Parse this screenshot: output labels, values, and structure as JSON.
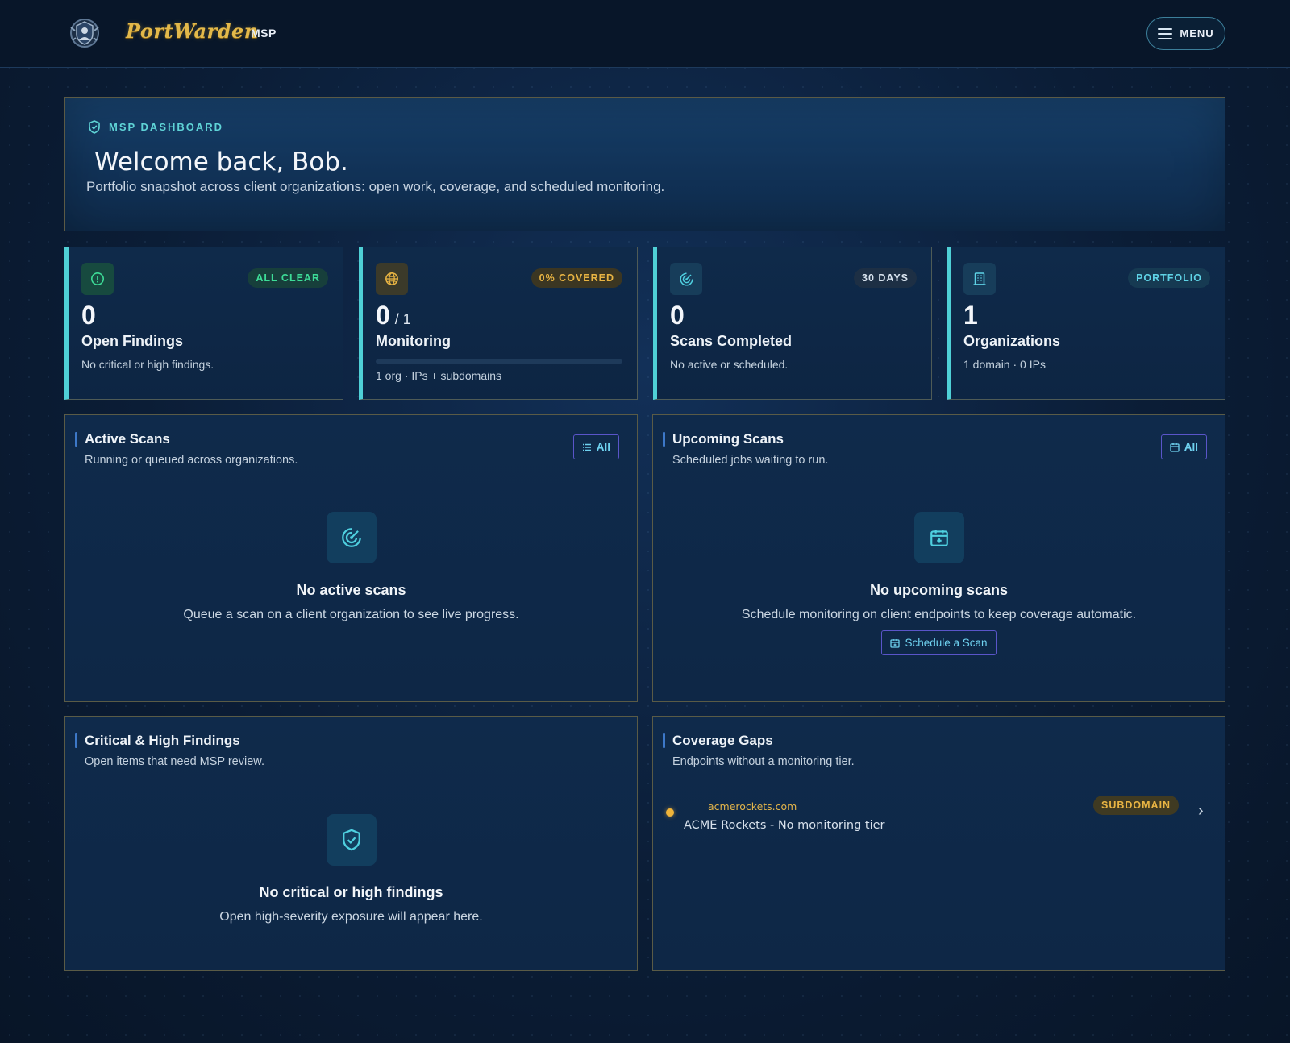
{
  "header": {
    "brand": "PortWarden",
    "brand_sub": "MSP",
    "menu_label": "MENU"
  },
  "hero": {
    "eyebrow": "MSP DASHBOARD",
    "title": "Welcome back, Bob.",
    "description": "Portfolio snapshot across client organizations: open work, coverage, and scheduled monitoring."
  },
  "stats": [
    {
      "badge": "ALL CLEAR",
      "value": "0",
      "label": "Open Findings",
      "sub": "No critical or high findings.",
      "icon": "alert-circle-icon",
      "badge_color": "#3ddc97"
    },
    {
      "badge": "0% COVERED",
      "value": "0",
      "value_suffix": "/ 1",
      "label": "Monitoring",
      "sub": "1 org · IPs + subdomains",
      "icon": "globe-icon",
      "badge_color": "#e8b443",
      "progress": 0
    },
    {
      "badge": "30 DAYS",
      "value": "0",
      "label": "Scans Completed",
      "sub": "No active or scheduled.",
      "icon": "radar-icon",
      "badge_color": "#d8e3ee"
    },
    {
      "badge": "PORTFOLIO",
      "value": "1",
      "label": "Organizations",
      "sub": "1 domain · 0 IPs",
      "icon": "building-icon",
      "badge_color": "#5fd3e6"
    }
  ],
  "panels": {
    "active_scans": {
      "title": "Active Scans",
      "subtitle": "Running or queued across organizations.",
      "button": "All",
      "empty_title": "No active scans",
      "empty_desc": "Queue a scan on a client organization to see live progress."
    },
    "upcoming_scans": {
      "title": "Upcoming Scans",
      "subtitle": "Scheduled jobs waiting to run.",
      "button": "All",
      "empty_title": "No upcoming scans",
      "empty_desc": "Schedule monitoring on client endpoints to keep coverage automatic.",
      "action": "Schedule a Scan"
    },
    "critical_findings": {
      "title": "Critical & High Findings",
      "subtitle": "Open items that need MSP review.",
      "empty_title": "No critical or high findings",
      "empty_desc": "Open high-severity exposure will appear here."
    },
    "coverage_gaps": {
      "title": "Coverage Gaps",
      "subtitle": "Endpoints without a monitoring tier.",
      "items": [
        {
          "domain": "acmerockets.com",
          "name": "ACME Rockets - No monitoring tier",
          "badge": "SUBDOMAIN"
        }
      ]
    }
  },
  "colors": {
    "accent_teal": "#4fd0d6",
    "accent_gold": "#e3b94a",
    "button_border": "#5a55c9"
  }
}
